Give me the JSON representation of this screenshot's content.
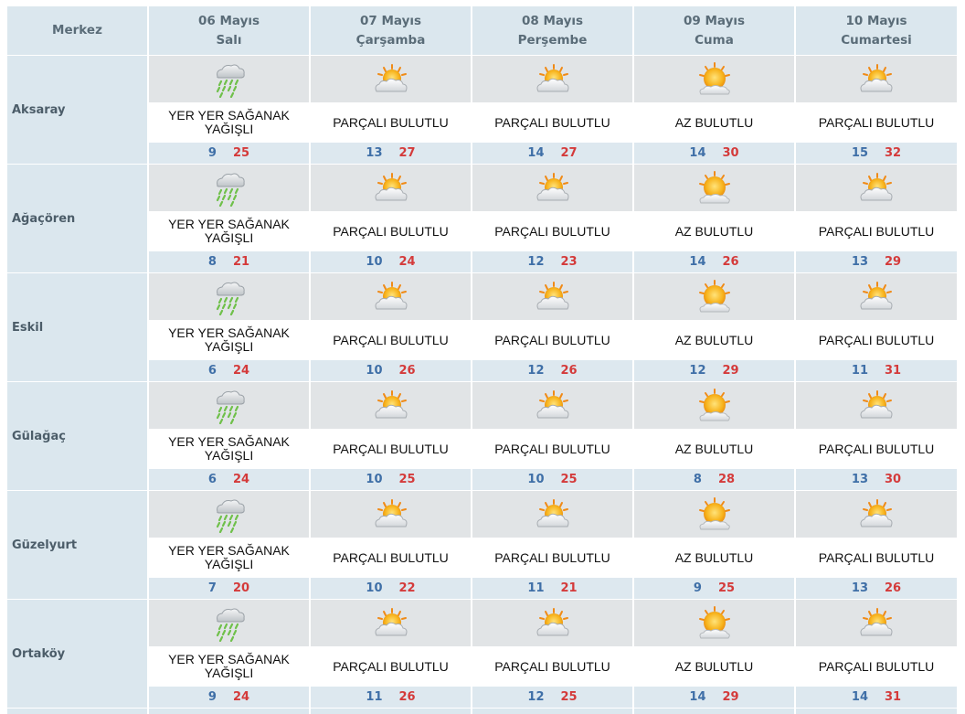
{
  "header": {
    "corner_label": "Merkez",
    "days": [
      {
        "date": "06 Mayıs",
        "weekday": "Salı"
      },
      {
        "date": "07 Mayıs",
        "weekday": "Çarşamba"
      },
      {
        "date": "08 Mayıs",
        "weekday": "Perşembe"
      },
      {
        "date": "09 Mayıs",
        "weekday": "Cuma"
      },
      {
        "date": "10 Mayıs",
        "weekday": "Cumartesi"
      }
    ]
  },
  "colors": {
    "header_bg": "#dbe7ee",
    "icon_band_bg": "#e1e4e6",
    "temp_band_bg": "#dde8ef",
    "min_temp": "#3f6fa7",
    "max_temp": "#d43a3a"
  },
  "locations": [
    {
      "name": "Aksaray",
      "forecast": [
        {
          "icon": "rain-cloud-icon",
          "condition": "YER YER SAĞANAK YAĞIŞLI",
          "min": "9",
          "max": "25"
        },
        {
          "icon": "partly-cloudy-icon",
          "condition": "PARÇALI BULUTLU",
          "min": "13",
          "max": "27"
        },
        {
          "icon": "partly-cloudy-icon",
          "condition": "PARÇALI BULUTLU",
          "min": "14",
          "max": "27"
        },
        {
          "icon": "mostly-sunny-icon",
          "condition": "AZ BULUTLU",
          "min": "14",
          "max": "30"
        },
        {
          "icon": "partly-cloudy-icon",
          "condition": "PARÇALI BULUTLU",
          "min": "15",
          "max": "32"
        }
      ]
    },
    {
      "name": "Ağaçören",
      "forecast": [
        {
          "icon": "rain-cloud-icon",
          "condition": "YER YER SAĞANAK YAĞIŞLI",
          "min": "8",
          "max": "21"
        },
        {
          "icon": "partly-cloudy-icon",
          "condition": "PARÇALI BULUTLU",
          "min": "10",
          "max": "24"
        },
        {
          "icon": "partly-cloudy-icon",
          "condition": "PARÇALI BULUTLU",
          "min": "12",
          "max": "23"
        },
        {
          "icon": "mostly-sunny-icon",
          "condition": "AZ BULUTLU",
          "min": "14",
          "max": "26"
        },
        {
          "icon": "partly-cloudy-icon",
          "condition": "PARÇALI BULUTLU",
          "min": "13",
          "max": "29"
        }
      ]
    },
    {
      "name": "Eskil",
      "forecast": [
        {
          "icon": "rain-cloud-icon",
          "condition": "YER YER SAĞANAK YAĞIŞLI",
          "min": "6",
          "max": "24"
        },
        {
          "icon": "partly-cloudy-icon",
          "condition": "PARÇALI BULUTLU",
          "min": "10",
          "max": "26"
        },
        {
          "icon": "partly-cloudy-icon",
          "condition": "PARÇALI BULUTLU",
          "min": "12",
          "max": "26"
        },
        {
          "icon": "mostly-sunny-icon",
          "condition": "AZ BULUTLU",
          "min": "12",
          "max": "29"
        },
        {
          "icon": "partly-cloudy-icon",
          "condition": "PARÇALI BULUTLU",
          "min": "11",
          "max": "31"
        }
      ]
    },
    {
      "name": "Gülağaç",
      "forecast": [
        {
          "icon": "rain-cloud-icon",
          "condition": "YER YER SAĞANAK YAĞIŞLI",
          "min": "6",
          "max": "24"
        },
        {
          "icon": "partly-cloudy-icon",
          "condition": "PARÇALI BULUTLU",
          "min": "10",
          "max": "25"
        },
        {
          "icon": "partly-cloudy-icon",
          "condition": "PARÇALI BULUTLU",
          "min": "10",
          "max": "25"
        },
        {
          "icon": "mostly-sunny-icon",
          "condition": "AZ BULUTLU",
          "min": "8",
          "max": "28"
        },
        {
          "icon": "partly-cloudy-icon",
          "condition": "PARÇALI BULUTLU",
          "min": "13",
          "max": "30"
        }
      ]
    },
    {
      "name": "Güzelyurt",
      "forecast": [
        {
          "icon": "rain-cloud-icon",
          "condition": "YER YER SAĞANAK YAĞIŞLI",
          "min": "7",
          "max": "20"
        },
        {
          "icon": "partly-cloudy-icon",
          "condition": "PARÇALI BULUTLU",
          "min": "10",
          "max": "22"
        },
        {
          "icon": "partly-cloudy-icon",
          "condition": "PARÇALI BULUTLU",
          "min": "11",
          "max": "21"
        },
        {
          "icon": "mostly-sunny-icon",
          "condition": "AZ BULUTLU",
          "min": "9",
          "max": "25"
        },
        {
          "icon": "partly-cloudy-icon",
          "condition": "PARÇALI BULUTLU",
          "min": "13",
          "max": "26"
        }
      ]
    },
    {
      "name": "Ortaköy",
      "forecast": [
        {
          "icon": "rain-cloud-icon",
          "condition": "YER YER SAĞANAK YAĞIŞLI",
          "min": "9",
          "max": "24"
        },
        {
          "icon": "partly-cloudy-icon",
          "condition": "PARÇALI BULUTLU",
          "min": "11",
          "max": "26"
        },
        {
          "icon": "partly-cloudy-icon",
          "condition": "PARÇALI BULUTLU",
          "min": "12",
          "max": "25"
        },
        {
          "icon": "mostly-sunny-icon",
          "condition": "AZ BULUTLU",
          "min": "14",
          "max": "29"
        },
        {
          "icon": "partly-cloudy-icon",
          "condition": "PARÇALI BULUTLU",
          "min": "14",
          "max": "31"
        }
      ]
    }
  ]
}
